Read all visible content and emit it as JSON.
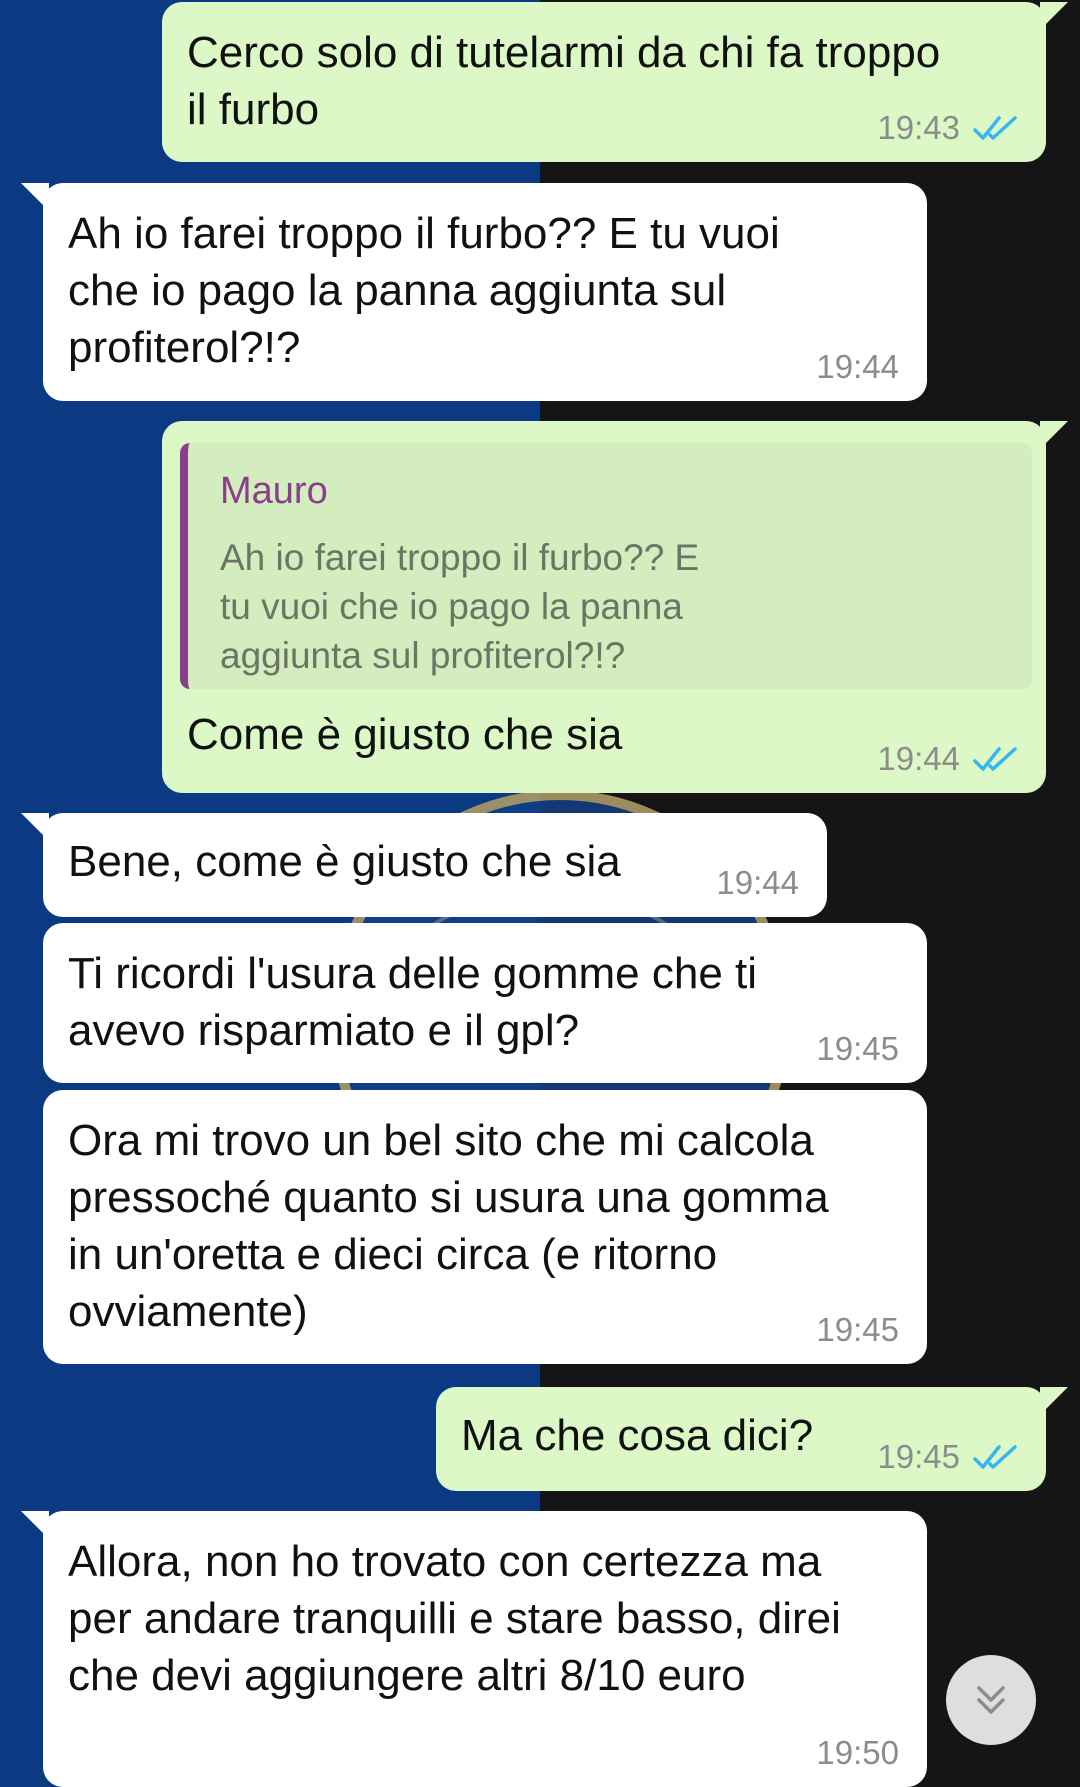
{
  "colors": {
    "outgoing_bubble": "#dcf8c6",
    "incoming_bubble": "#ffffff",
    "read_ticks": "#34b7f1",
    "quote_accent": "#8a3f8d",
    "bg_blue": "#0b3a82",
    "bg_dark": "#151515"
  },
  "messages": [
    {
      "direction": "outgoing",
      "text": "Cerco solo di tutelarmi da chi fa troppo\nil furbo",
      "time": "19:43",
      "status_icon": "double-check-read-icon"
    },
    {
      "direction": "incoming",
      "text": "Ah io farei troppo il furbo?? E tu vuoi\nche io pago la panna aggiunta sul\nprofiterol?!?",
      "time": "19:44"
    },
    {
      "direction": "outgoing",
      "quote": {
        "author": "Mauro",
        "text": "Ah io farei troppo il furbo?? E\ntu vuoi che io pago la panna\naggiunta sul profiterol?!?"
      },
      "text": "Come è giusto che sia",
      "time": "19:44",
      "status_icon": "double-check-read-icon"
    },
    {
      "direction": "incoming",
      "text": "Bene, come è giusto che sia",
      "time": "19:44"
    },
    {
      "direction": "incoming",
      "text": "Ti ricordi l'usura delle gomme che ti\navevo risparmiato e il gpl?",
      "time": "19:45"
    },
    {
      "direction": "incoming",
      "text": "Ora mi trovo un bel sito che mi calcola\npressoché quanto si usura una gomma\nin un'oretta e dieci circa (e ritorno\novviamente)",
      "time": "19:45"
    },
    {
      "direction": "outgoing",
      "text": "Ma che cosa dici?",
      "time": "19:45",
      "status_icon": "double-check-read-icon"
    },
    {
      "direction": "incoming",
      "text": "Allora, non ho trovato con certezza ma\nper andare tranquilli e stare basso, direi\nche devi aggiungere altri 8/10 euro",
      "time": "19:50"
    }
  ],
  "scroll_button": {
    "icon": "double-chevron-down-icon"
  }
}
